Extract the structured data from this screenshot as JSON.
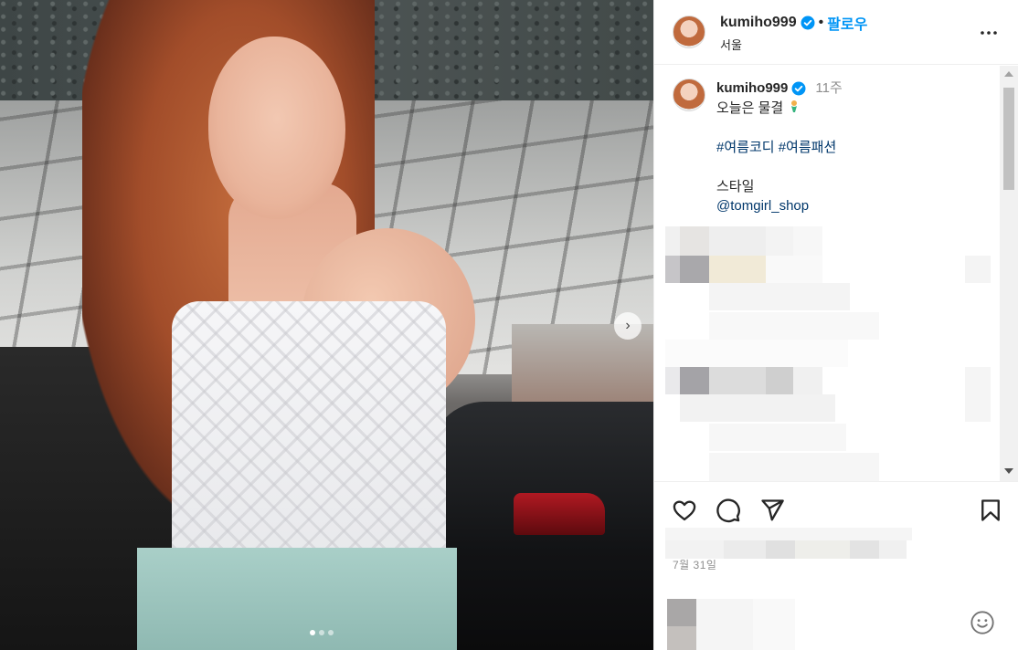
{
  "post": {
    "username": "kumiho999",
    "follow_label": "팔로우",
    "separator": "•",
    "location": "서울",
    "more_label": "•••"
  },
  "caption": {
    "username": "kumiho999",
    "time": "11주",
    "line1": "오늘은 물결",
    "hashtag1": "#여름코디",
    "hashtag2": "#여름패션",
    "line3": "스타일",
    "mention": "@tomgirl_shop"
  },
  "actions": {
    "like_icon": "heart-icon",
    "comment_icon": "comment-icon",
    "share_icon": "share-icon",
    "save_icon": "bookmark-icon",
    "emoji_icon": "emoji-icon"
  },
  "date": "7월 31일",
  "colors": {
    "accent": "#0095f6",
    "link": "#00376b",
    "muted": "#8e8e8e",
    "text": "#262626",
    "verified": "#0095f6"
  }
}
